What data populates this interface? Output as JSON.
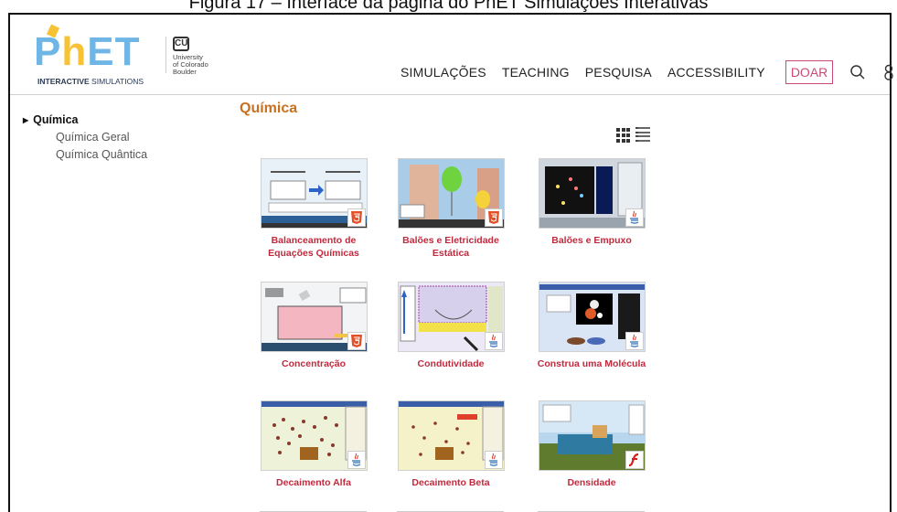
{
  "caption": "Figura 17 – Interface da página do PhET Simulações Interativas",
  "logo": {
    "letters_p": "P",
    "letters_h": "h",
    "letters_et": "ET",
    "sub_bold": "INTERACTIVE",
    "sub_rest": " SIMULATIONS",
    "cu_mark": "CU",
    "cu_line1": "University",
    "cu_line2": "of Colorado",
    "cu_line3": "Boulder"
  },
  "nav": {
    "items": [
      "SIMULAÇÕES",
      "TEACHING",
      "PESQUISA",
      "ACCESSIBILITY"
    ],
    "donate": "DOAR"
  },
  "sidebar": {
    "heading": "Química",
    "items": [
      "Química Geral",
      "Química Quântica"
    ]
  },
  "main": {
    "title": "Química"
  },
  "cards": [
    {
      "title": "Balanceamento de Equações Químicas",
      "badge": "html5"
    },
    {
      "title": "Balões e Eletricidade Estática",
      "badge": "html5"
    },
    {
      "title": "Balões e Empuxo",
      "badge": "java"
    },
    {
      "title": "Concentração",
      "badge": "html5"
    },
    {
      "title": "Condutividade",
      "badge": "java"
    },
    {
      "title": "Construa uma Molécula",
      "badge": "java"
    },
    {
      "title": "Decaimento Alfa",
      "badge": "java"
    },
    {
      "title": "Decaimento Beta",
      "badge": "java"
    },
    {
      "title": "Densidade",
      "badge": "flash"
    }
  ],
  "colors": {
    "accent_title": "#c7701f",
    "card_title": "#c02a3e",
    "donate": "#c94a73",
    "html5": "#e34f26",
    "java_blue": "#2c6db5",
    "java_red": "#d93a2b",
    "flash": "#d41f1f"
  }
}
